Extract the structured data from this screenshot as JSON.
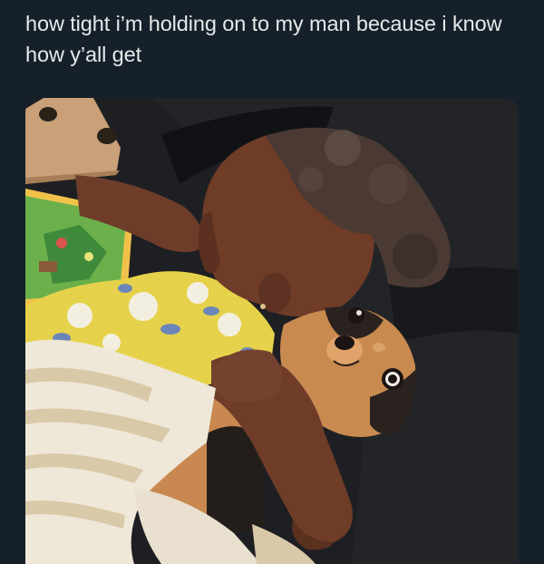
{
  "post": {
    "text": "how tight i’m holding on to my man because i know how y’all get"
  },
  "media": {
    "icon": "photo-baby-hugging-dog",
    "colors": {
      "page_background": "#15202b",
      "text": "#e7e9ea",
      "car_seat": "#1c1d21",
      "dress_yellow": "#e9d54a",
      "dress_flower": "#f4f1e2",
      "dress_leaf": "#6b86b8",
      "skin": "#7a4530",
      "hair": "#4a3a33",
      "dog_tan": "#c98a4f",
      "dog_black": "#2a221f",
      "blanket": "#efe7d8",
      "blanket_stripe": "#d8c9a8"
    }
  }
}
